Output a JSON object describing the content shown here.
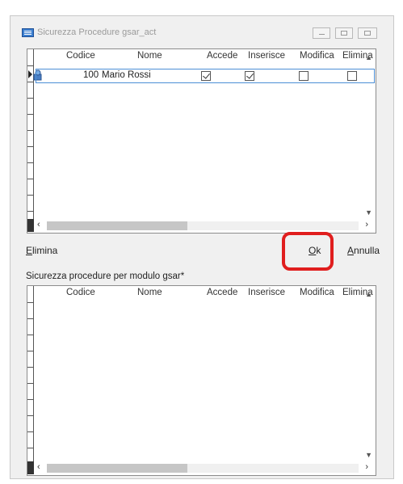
{
  "window": {
    "title": "Sicurezza Procedure gsar_act"
  },
  "grid1": {
    "columns": [
      "Codice",
      "Nome",
      "Accede",
      "Inserisce",
      "Modifica",
      "Elimina"
    ],
    "rows": [
      {
        "codice": "100",
        "nome": "Mario Rossi",
        "accede": true,
        "inserisce": true,
        "modifica": false,
        "elimina": false
      }
    ]
  },
  "actions": {
    "elimina_first": "E",
    "elimina_rest": "limina",
    "ok_first": "O",
    "ok_rest": "k",
    "annulla_first": "A",
    "annulla_rest": "nnulla"
  },
  "section2": {
    "label": "Sicurezza procedure per modulo gsar*"
  },
  "grid2": {
    "columns": [
      "Codice",
      "Nome",
      "Accede",
      "Inserisce",
      "Modifica",
      "Elimina"
    ],
    "rows": []
  },
  "colors": {
    "highlight": "#e01e1e",
    "selection_border": "#4c8fd6"
  },
  "icons": [
    "app-icon",
    "record-indicator-icon",
    "row-user-icon",
    "scroll-up-icon",
    "scroll-down-icon",
    "scroll-left-icon",
    "scroll-right-icon"
  ]
}
